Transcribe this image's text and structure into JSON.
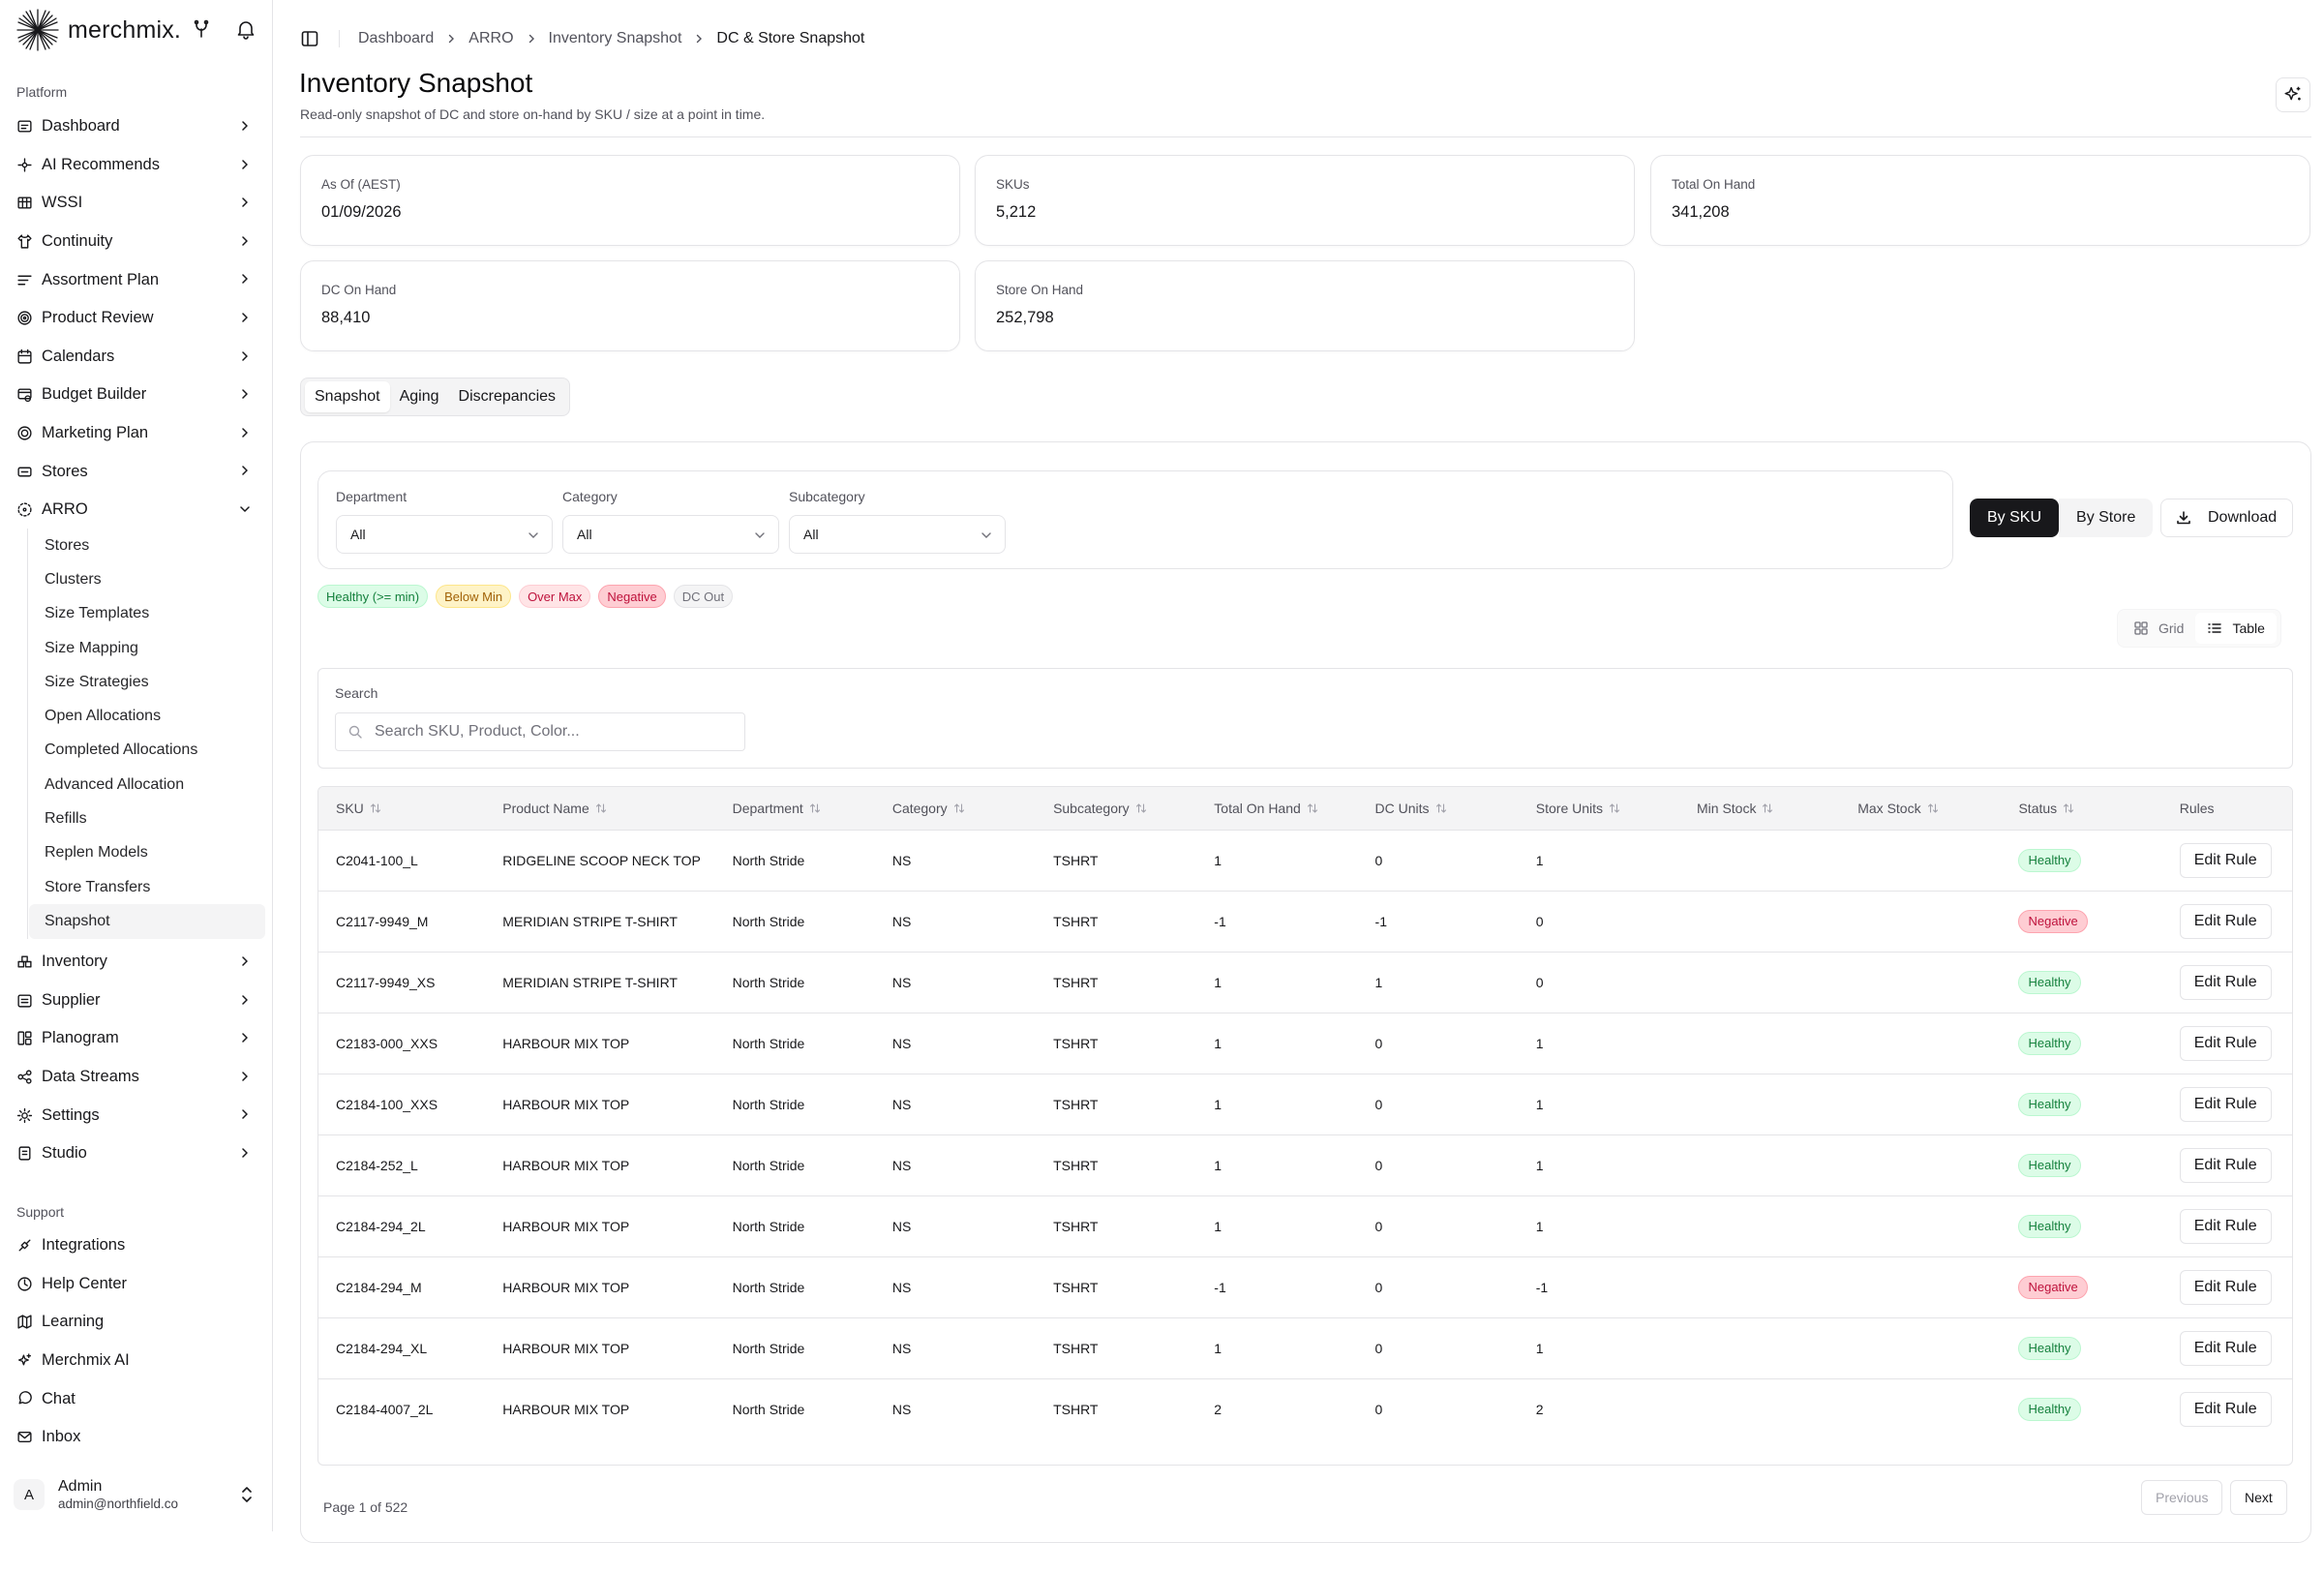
{
  "app": {
    "name": "merchmix."
  },
  "sidebar": {
    "platform_label": "Platform",
    "support_label": "Support",
    "items": [
      {
        "label": "Dashboard",
        "icon": "dashboard-icon"
      },
      {
        "label": "AI Recommends",
        "icon": "ai-recommends-icon"
      },
      {
        "label": "WSSI",
        "icon": "grid-icon"
      },
      {
        "label": "Continuity",
        "icon": "shirt-icon"
      },
      {
        "label": "Assortment Plan",
        "icon": "sliders-icon"
      },
      {
        "label": "Product Review",
        "icon": "target-icon"
      },
      {
        "label": "Calendars",
        "icon": "calendar-icon"
      },
      {
        "label": "Budget Builder",
        "icon": "budget-icon"
      },
      {
        "label": "Marketing Plan",
        "icon": "marketing-icon"
      },
      {
        "label": "Stores",
        "icon": "store-icon"
      },
      {
        "label": "ARRO",
        "icon": "arro-icon"
      }
    ],
    "arro_sub": [
      "Stores",
      "Clusters",
      "Size Templates",
      "Size Mapping",
      "Size Strategies",
      "Open Allocations",
      "Completed Allocations",
      "Advanced Allocation",
      "Refills",
      "Replen Models",
      "Store Transfers",
      "Snapshot"
    ],
    "items_after": [
      {
        "label": "Inventory",
        "icon": "inventory-icon"
      },
      {
        "label": "Supplier",
        "icon": "supplier-icon"
      },
      {
        "label": "Planogram",
        "icon": "planogram-icon"
      },
      {
        "label": "Data Streams",
        "icon": "share-icon"
      },
      {
        "label": "Settings",
        "icon": "settings-icon"
      },
      {
        "label": "Studio",
        "icon": "studio-icon"
      }
    ],
    "support_items": [
      {
        "label": "Integrations",
        "icon": "plug-icon"
      },
      {
        "label": "Help Center",
        "icon": "help-icon"
      },
      {
        "label": "Learning",
        "icon": "map-icon"
      },
      {
        "label": "Merchmix AI",
        "icon": "sparkle-icon"
      },
      {
        "label": "Chat",
        "icon": "chat-icon"
      },
      {
        "label": "Inbox",
        "icon": "mail-icon"
      }
    ],
    "user": {
      "initial": "A",
      "name": "Admin",
      "email": "admin@northfield.co"
    }
  },
  "breadcrumb": [
    "Dashboard",
    "ARRO",
    "Inventory Snapshot",
    "DC & Store Snapshot"
  ],
  "page": {
    "title": "Inventory Snapshot",
    "subtitle": "Read-only snapshot of DC and store on-hand by SKU / size at a point in time."
  },
  "stats": [
    {
      "label": "As Of (AEST)",
      "value": "01/09/2026"
    },
    {
      "label": "SKUs",
      "value": "5,212"
    },
    {
      "label": "Total On Hand",
      "value": "341,208"
    },
    {
      "label": "DC On Hand",
      "value": "88,410"
    },
    {
      "label": "Store On Hand",
      "value": "252,798"
    }
  ],
  "tabs": [
    "Snapshot",
    "Aging",
    "Discrepancies"
  ],
  "filters": {
    "department": {
      "label": "Department",
      "value": "All"
    },
    "category": {
      "label": "Category",
      "value": "All"
    },
    "subcategory": {
      "label": "Subcategory",
      "value": "All"
    }
  },
  "mode": {
    "by_sku": "By SKU",
    "by_store": "By Store",
    "download": "Download"
  },
  "legend": [
    {
      "label": "Healthy (>= min)",
      "bg": "#dcfce7",
      "fg": "#15803d",
      "border": "#bbf7d0"
    },
    {
      "label": "Below Min",
      "bg": "#fef3c7",
      "fg": "#a16207",
      "border": "#fde68a"
    },
    {
      "label": "Over Max",
      "bg": "#ffe4e6",
      "fg": "#be123c",
      "border": "#fecdd3"
    },
    {
      "label": "Negative",
      "bg": "#fecdd3",
      "fg": "#be123c",
      "border": "#fda4af"
    },
    {
      "label": "DC Out",
      "bg": "#f4f4f5",
      "fg": "#71717a",
      "border": "#e4e4e7"
    }
  ],
  "view": {
    "grid": "Grid",
    "table": "Table"
  },
  "search": {
    "label": "Search",
    "placeholder": "Search SKU, Product, Color..."
  },
  "table": {
    "columns": [
      "SKU",
      "Product Name",
      "Department",
      "Category",
      "Subcategory",
      "Total On Hand",
      "DC Units",
      "Store Units",
      "Min Stock",
      "Max Stock",
      "Status",
      "Rules"
    ],
    "action_label": "Edit Rule",
    "rows": [
      [
        "C2041-100_L",
        "RIDGELINE SCOOP NECK TOP",
        "North Stride",
        "NS",
        "TSHRT",
        "1",
        "0",
        "1",
        "",
        "",
        "Healthy"
      ],
      [
        "C2117-9949_M",
        "MERIDIAN STRIPE T-SHIRT",
        "North Stride",
        "NS",
        "TSHRT",
        "-1",
        "-1",
        "0",
        "",
        "",
        "Negative"
      ],
      [
        "C2117-9949_XS",
        "MERIDIAN STRIPE T-SHIRT",
        "North Stride",
        "NS",
        "TSHRT",
        "1",
        "1",
        "0",
        "",
        "",
        "Healthy"
      ],
      [
        "C2183-000_XXS",
        "HARBOUR MIX TOP",
        "North Stride",
        "NS",
        "TSHRT",
        "1",
        "0",
        "1",
        "",
        "",
        "Healthy"
      ],
      [
        "C2184-100_XXS",
        "HARBOUR MIX TOP",
        "North Stride",
        "NS",
        "TSHRT",
        "1",
        "0",
        "1",
        "",
        "",
        "Healthy"
      ],
      [
        "C2184-252_L",
        "HARBOUR MIX TOP",
        "North Stride",
        "NS",
        "TSHRT",
        "1",
        "0",
        "1",
        "",
        "",
        "Healthy"
      ],
      [
        "C2184-294_2L",
        "HARBOUR MIX TOP",
        "North Stride",
        "NS",
        "TSHRT",
        "1",
        "0",
        "1",
        "",
        "",
        "Healthy"
      ],
      [
        "C2184-294_M",
        "HARBOUR MIX TOP",
        "North Stride",
        "NS",
        "TSHRT",
        "-1",
        "0",
        "-1",
        "",
        "",
        "Negative"
      ],
      [
        "C2184-294_XL",
        "HARBOUR MIX TOP",
        "North Stride",
        "NS",
        "TSHRT",
        "1",
        "0",
        "1",
        "",
        "",
        "Healthy"
      ],
      [
        "C2184-4007_2L",
        "HARBOUR MIX TOP",
        "North Stride",
        "NS",
        "TSHRT",
        "2",
        "0",
        "2",
        "",
        "",
        "Healthy"
      ]
    ]
  },
  "pagination": {
    "info": "Page 1 of 522",
    "previous": "Previous",
    "next": "Next"
  }
}
